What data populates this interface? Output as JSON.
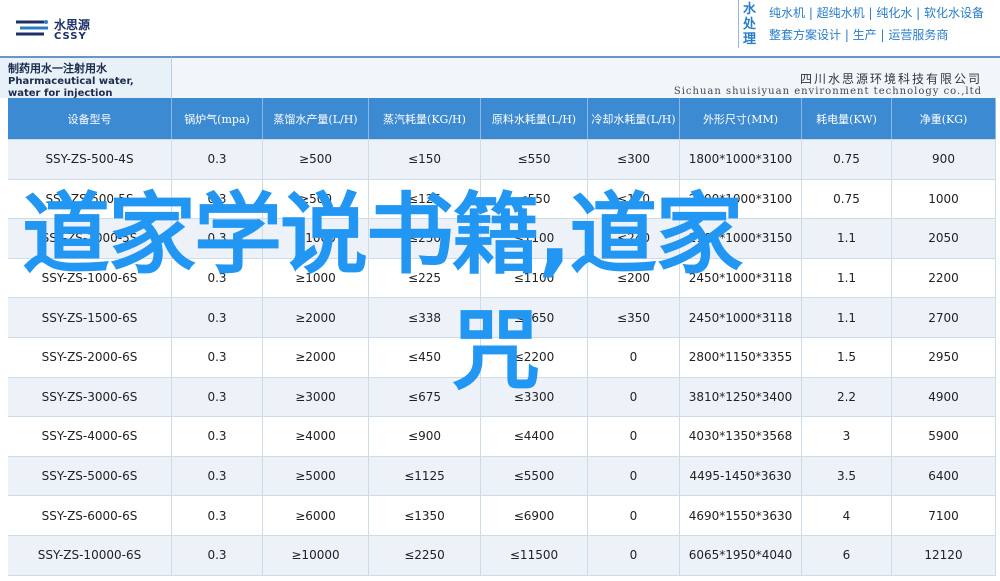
{
  "header": {
    "logo_cn": "水思源",
    "logo_en": "CSSY",
    "brand_vertical": "水处理",
    "brand_line1": "纯水机 | 超纯水机 | 纯化水 | 软化水设备",
    "brand_line2": "整套方案设计 | 生产 | 运营服务商"
  },
  "title": {
    "cn": "制药用水一注射用水",
    "en": "Pharmaceutical water, water for injection",
    "company_cn": "四川水思源环境科技有限公司",
    "company_en": "Sichuan shuisiyuan environment technology co.,ltd"
  },
  "table": {
    "headers": [
      "设备型号",
      "锅炉气(mpa)",
      "蒸馏水产量(L/H)",
      "蒸汽耗量(KG/H)",
      "原料水耗量(L/H)",
      "冷却水耗量(L/H)",
      "外形尺寸(MM)",
      "耗电量(KW)",
      "净重(KG)"
    ],
    "rows": [
      [
        "SSY-ZS-500-4S",
        "0.3",
        "≥500",
        "≤150",
        "≤550",
        "≤300",
        "1800*1000*3100",
        "0.75",
        "900"
      ],
      [
        "SSY-ZS-500-5S",
        "0.3",
        "≥500",
        "≤125",
        "≤550",
        "≤120",
        "2000*1000*3100",
        "0.75",
        "1000"
      ],
      [
        "SSY-ZS-1000-5S",
        "0.3",
        "≥1000",
        "≤250",
        "≤1100",
        "≤240",
        "2100*1000*3150",
        "1.1",
        "2050"
      ],
      [
        "SSY-ZS-1000-6S",
        "0.3",
        "≥1000",
        "≤225",
        "≤1100",
        "≤200",
        "2450*1000*3118",
        "1.1",
        "2200"
      ],
      [
        "SSY-ZS-1500-6S",
        "0.3",
        "≥2000",
        "≤338",
        "≤1650",
        "≤350",
        "2450*1000*3118",
        "1.1",
        "2700"
      ],
      [
        "SSY-ZS-2000-6S",
        "0.3",
        "≥2000",
        "≤450",
        "≤2200",
        "0",
        "2800*1150*3355",
        "1.5",
        "2950"
      ],
      [
        "SSY-ZS-3000-6S",
        "0.3",
        "≥3000",
        "≤675",
        "≤3300",
        "0",
        "3810*1250*3400",
        "2.2",
        "4900"
      ],
      [
        "SSY-ZS-4000-6S",
        "0.3",
        "≥4000",
        "≤900",
        "≤4400",
        "0",
        "4030*1350*3568",
        "3",
        "5900"
      ],
      [
        "SSY-ZS-5000-6S",
        "0.3",
        "≥5000",
        "≤1125",
        "≤5500",
        "0",
        "4495-1450*3630",
        "3.5",
        "6400"
      ],
      [
        "SSY-ZS-6000-6S",
        "0.3",
        "≥6000",
        "≤1350",
        "≤6900",
        "0",
        "4690*1550*3630",
        "4",
        "7100"
      ],
      [
        "SSY-ZS-10000-6S",
        "0.3",
        "≥10000",
        "≤2250",
        "≤11500",
        "0",
        "6065*1950*4040",
        "6",
        "12120"
      ]
    ]
  },
  "overlay": {
    "line1": "道家学说书籍,道家",
    "line2": "咒"
  },
  "colors": {
    "header_blue": "#3c8ad2",
    "overlay_blue": "#2196f3",
    "brand_blue": "#2a7dc7"
  }
}
